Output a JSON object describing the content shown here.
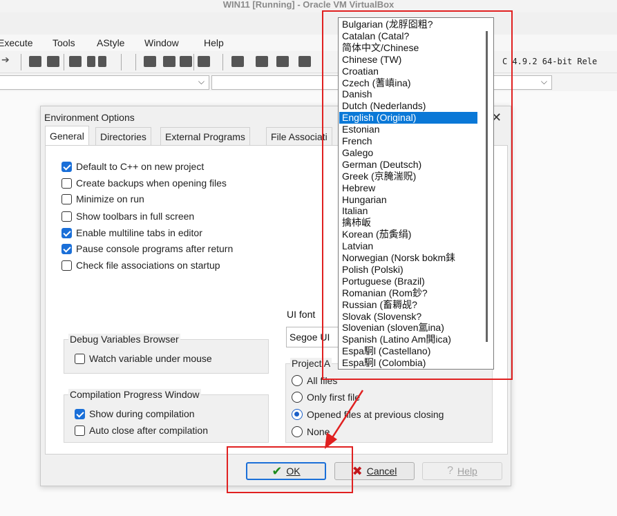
{
  "window_title": "WIN11 [Running] - Oracle VM VirtualBox",
  "menu": [
    "Execute",
    "Tools",
    "AStyle",
    "Window",
    "Help"
  ],
  "toolbar": {
    "compiler_label": "C 4.9.2 64-bit Rele"
  },
  "dialog": {
    "title": "Environment Options",
    "close_glyph": "✕",
    "tabs": [
      "General",
      "Directories",
      "External Programs",
      "File Associati"
    ],
    "checkboxes": [
      {
        "label": "Default to C++ on new project",
        "checked": true
      },
      {
        "label": "Create backups when opening files",
        "checked": false
      },
      {
        "label": "Minimize on run",
        "checked": false
      },
      {
        "label": "Show toolbars in full screen",
        "checked": false
      },
      {
        "label": "Enable multiline tabs in editor",
        "checked": true
      },
      {
        "label": "Pause console programs after return",
        "checked": true
      },
      {
        "label": "Check file associations on startup",
        "checked": false
      }
    ],
    "debug_group": {
      "title": "Debug Variables Browser",
      "watch_label": "Watch variable under mouse",
      "watch_checked": false
    },
    "compilation_group": {
      "title": "Compilation Progress Window",
      "show_label": "Show during compilation",
      "show_checked": true,
      "autoclose_label": "Auto close after compilation",
      "autoclose_checked": false
    },
    "ui_font": {
      "label": "UI font",
      "value": "Segoe UI"
    },
    "project_group": {
      "title": "Project A",
      "options": [
        "All files",
        "Only first file",
        "Opened files at previous closing",
        "None"
      ],
      "selected_index": 2
    },
    "buttons": {
      "ok": "OK",
      "cancel": "Cancel",
      "help": "Help"
    }
  },
  "language_dropdown": {
    "selected": "English (Original)",
    "items": [
      "Bulgarian (龙脬囵粗?",
      "Catalan (Catal?",
      "简体中文/Chinese",
      "Chinese (TW)",
      "Croatian",
      "Czech (蓍嵮ina)",
      "Danish",
      "Dutch (Nederlands)",
      "English (Original)",
      "Estonian",
      "French",
      "Galego",
      "German (Deutsch)",
      "Greek (京腌湍贶)",
      "Hebrew",
      "Hungarian",
      "Italian",
      "擒柿岅",
      "Korean (茄夤绢)",
      "Latvian",
      "Norwegian (Norsk bokm銇",
      "Polish (Polski)",
      "Portuguese (Brazil)",
      "Romanian (Rom鈔?",
      "Russian (畜耨觇?",
      "Slovak (Slovensk?",
      "Slovenian (sloven氲ina)",
      "Spanish (Latino Am閧ica)",
      "Espa駉l (Castellano)",
      "Espa駉l (Colombia)"
    ]
  },
  "annotation_colors": {
    "highlight": "#e02020",
    "accent": "#1a6fd8"
  }
}
